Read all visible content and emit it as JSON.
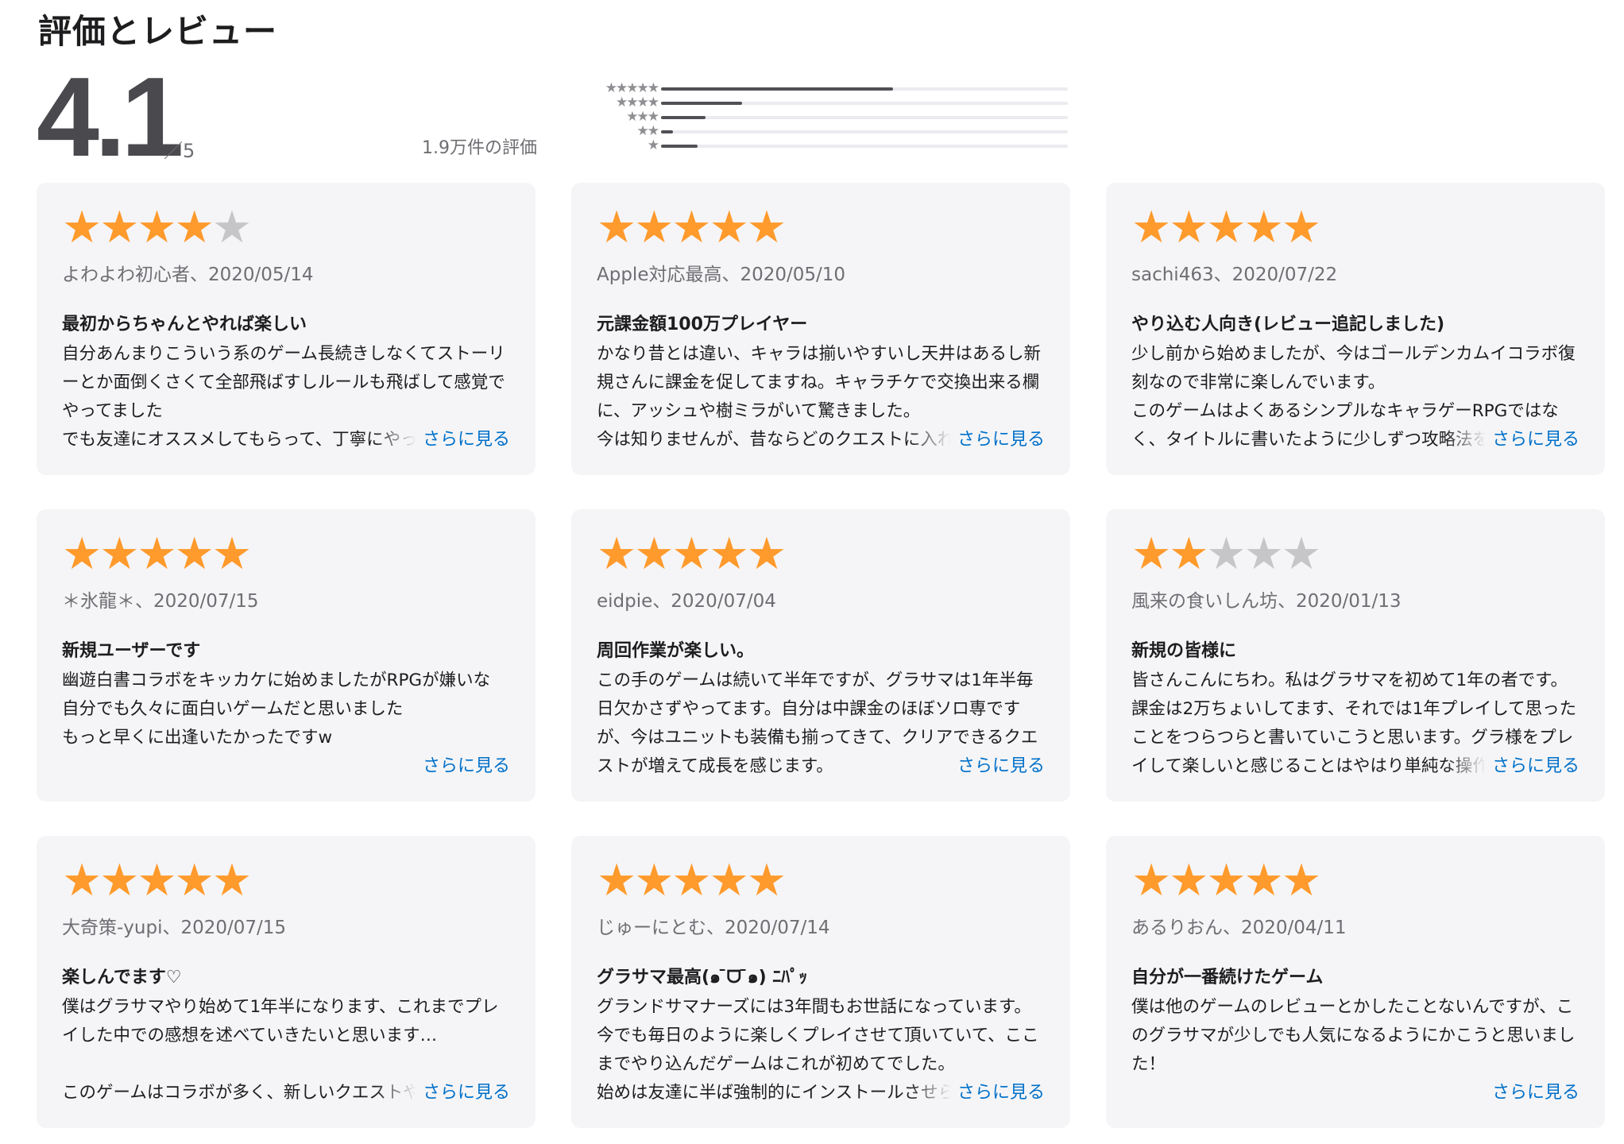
{
  "section_title": "評価とレビュー",
  "summary": {
    "average": "4.1",
    "out_of": "／5",
    "total_text": "1.9万件の評価"
  },
  "histogram": [
    {
      "stars": "★★★★★",
      "fraction": 0.57
    },
    {
      "stars": "★★★★",
      "fraction": 0.2
    },
    {
      "stars": "★★★",
      "fraction": 0.11
    },
    {
      "stars": "★★",
      "fraction": 0.03
    },
    {
      "stars": "★",
      "fraction": 0.09
    }
  ],
  "colors": {
    "star_on": "#ff9a2c",
    "star_off": "#c6c6c8",
    "link": "#0070c9",
    "card_bg": "#f5f5f7"
  },
  "more_label": "さらに見る",
  "reviews": [
    {
      "rating": 4,
      "meta": "よわよわ初心者、2020/05/14",
      "title": "最初からちゃんとやれば楽しい",
      "body": "自分あんまりこういう系のゲーム長続きしなくてストーリーとか面倒くさくて全部飛ばすしルールも飛ばして感覚でやってました\nでも友達にオススメしてもらって、丁寧にやってみ"
    },
    {
      "rating": 5,
      "meta": "Apple対応最高、2020/05/10",
      "title": "元課金額100万プレイヤー",
      "body": "かなり昔とは違い、キャラは揃いやすいし天井はあるし新規さんに課金を促してますね。キャラチケで交換出来る欄に、アッシュや樹ミラがいて驚きました。\n今は知りませんが、昔ならどのクエストに入れて"
    },
    {
      "rating": 5,
      "meta": "sachi463、2020/07/22",
      "title": "やり込む人向き(レビュー追記しました)",
      "body": "少し前から始めましたが、今はゴールデンカムイコラボ復刻なので非常に楽しんでいます。\nこのゲームはよくあるシンプルなキャラゲーRPGではなく、タイトルに書いたように少しずつ攻略法を把握し"
    },
    {
      "rating": 5,
      "meta": "＊氷龍＊、2020/07/15",
      "title": "新規ユーザーです",
      "body": "幽遊白書コラボをキッカケに始めましたがRPGが嫌いな\n自分でも久々に面白いゲームだと思いました\nもっと早くに出逢いたかったですw"
    },
    {
      "rating": 5,
      "meta": "eidpie、2020/07/04",
      "title": "周回作業が楽しい。",
      "body": "この手のゲームは続いて半年ですが、グラサマは1年半毎日欠かさずやってます。自分は中課金のほぼソロ専ですが、今はユニットも装備も揃ってきて、クリアできるクエストが増えて成長を感じます。"
    },
    {
      "rating": 2,
      "meta": "風来の食いしん坊、2020/01/13",
      "title": "新規の皆様に",
      "body": "皆さんこんにちわ。私はグラサマを初めて1年の者です。課金は2万ちょいしてます、それでは1年プレイして思ったことをつらつらと書いていこうと思います。グラ様をプレイして楽しいと感じることはやはり単純な操作では無"
    },
    {
      "rating": 5,
      "meta": "大奇策-yupi、2020/07/15",
      "title": "楽しんでます♡",
      "body": "僕はグラサマやり始めて1年半になります、これまでプレイした中での感想を述べていきたいと思います…\n\nこのゲームはコラボが多く、新しいクエストや新"
    },
    {
      "rating": 5,
      "meta": "じゅーにとむ、2020/07/14",
      "title": "グラサマ最高(๑ ̄ᗜ ̄๑) ﾆﾊﾟｯ",
      "body": "グランドサマナーズには3年間もお世話になっています。今でも毎日のように楽しくプレイさせて頂いていて、ここまでやり込んだゲームはこれが初めてでした。\n始めは友達に半ば強制的にインストールさせられ"
    },
    {
      "rating": 5,
      "meta": "あるりおん、2020/04/11",
      "title": "自分が一番続けたゲーム",
      "body": "僕は他のゲームのレビューとかしたことないんですが、このグラサマが少しでも人気になるようにかこうと思いました！"
    }
  ]
}
